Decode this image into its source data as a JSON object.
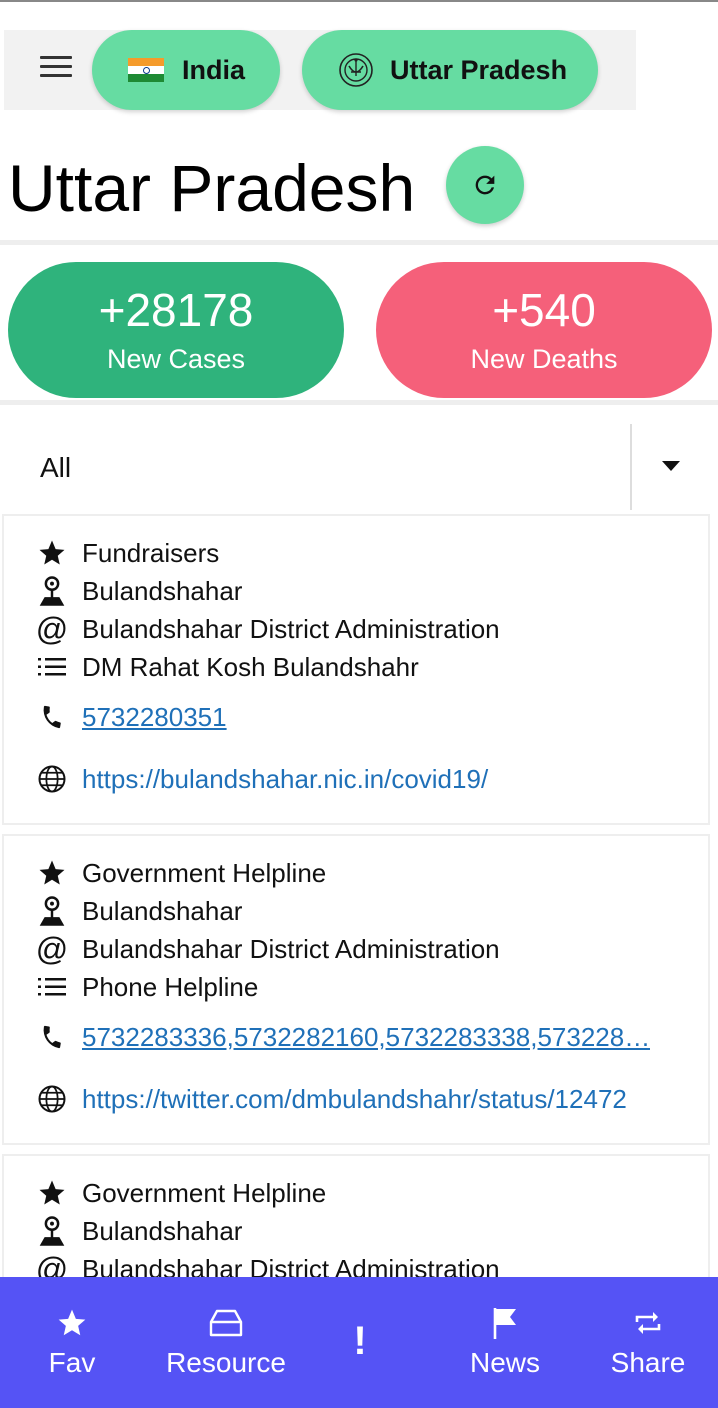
{
  "nav": {
    "menu_icon": "hamburger-icon",
    "country": {
      "label": "India",
      "icon": "india-flag-icon"
    },
    "state": {
      "label": "Uttar Pradesh",
      "icon": "up-emblem-icon"
    }
  },
  "header": {
    "title": "Uttar Pradesh",
    "refresh_icon": "refresh-icon"
  },
  "stats": {
    "cases": {
      "value": "+28178",
      "label": "New Cases",
      "color": "#2fb37c"
    },
    "deaths": {
      "value": "+540",
      "label": "New Deaths",
      "color": "#f5607a"
    }
  },
  "filter": {
    "selected": "All"
  },
  "resources": [
    {
      "category": "Fundraisers",
      "city": "Bulandshahar",
      "organisation": "Bulandshahar District Administration",
      "description": "DM Rahat Kosh Bulandshahr",
      "phone": "5732280351",
      "url": "https://bulandshahar.nic.in/covid19/"
    },
    {
      "category": "Government Helpline",
      "city": "Bulandshahar",
      "organisation": "Bulandshahar District Administration",
      "description": "Phone Helpline",
      "phone": "5732283336,5732282160,5732283338,573228…",
      "url": "https://twitter.com/dmbulandshahr/status/12472"
    },
    {
      "category": "Government Helpline",
      "city": "Bulandshahar",
      "organisation": "Bulandshahar District Administration"
    }
  ],
  "bottom_nav": {
    "fav": "Fav",
    "resource": "Resource",
    "alert": "!",
    "news": "News",
    "share": "Share"
  },
  "colors": {
    "accent": "#66dca2",
    "bottom_bar": "#5553f5",
    "link": "#1f70b8"
  }
}
